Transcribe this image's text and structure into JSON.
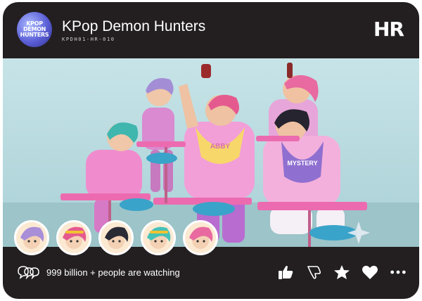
{
  "card": {
    "logo_lines": [
      "KPOP",
      "DEMON",
      "HUNTERS"
    ],
    "title": "KPop Demon Hunters",
    "code": "KPDH01-HR-010",
    "rarity": "HR"
  },
  "scene": {
    "bib_labels": [
      "ABBY",
      "MYSTERY"
    ]
  },
  "avatars": [
    {
      "name": "avatar-purple-hair",
      "hair_color": "#a98fd8"
    },
    {
      "name": "avatar-pink-hair",
      "hair_color": "#e55a8e"
    },
    {
      "name": "avatar-black-hair",
      "hair_color": "#2a2a35"
    },
    {
      "name": "avatar-teal-hair",
      "hair_color": "#46c2b8"
    },
    {
      "name": "avatar-rose-hair",
      "hair_color": "#e86aa0"
    }
  ],
  "footer": {
    "viewers_text": "999 billion + people are watching",
    "actions": [
      "thumbs-up-icon",
      "thumbs-down-icon",
      "star-icon",
      "heart-icon",
      "more-icon"
    ]
  },
  "colors": {
    "card_bg": "#231f20",
    "wall": "#b9dce0",
    "pink_outfit": "#f2a3d6",
    "accent_pink": "#ec6bb0"
  }
}
